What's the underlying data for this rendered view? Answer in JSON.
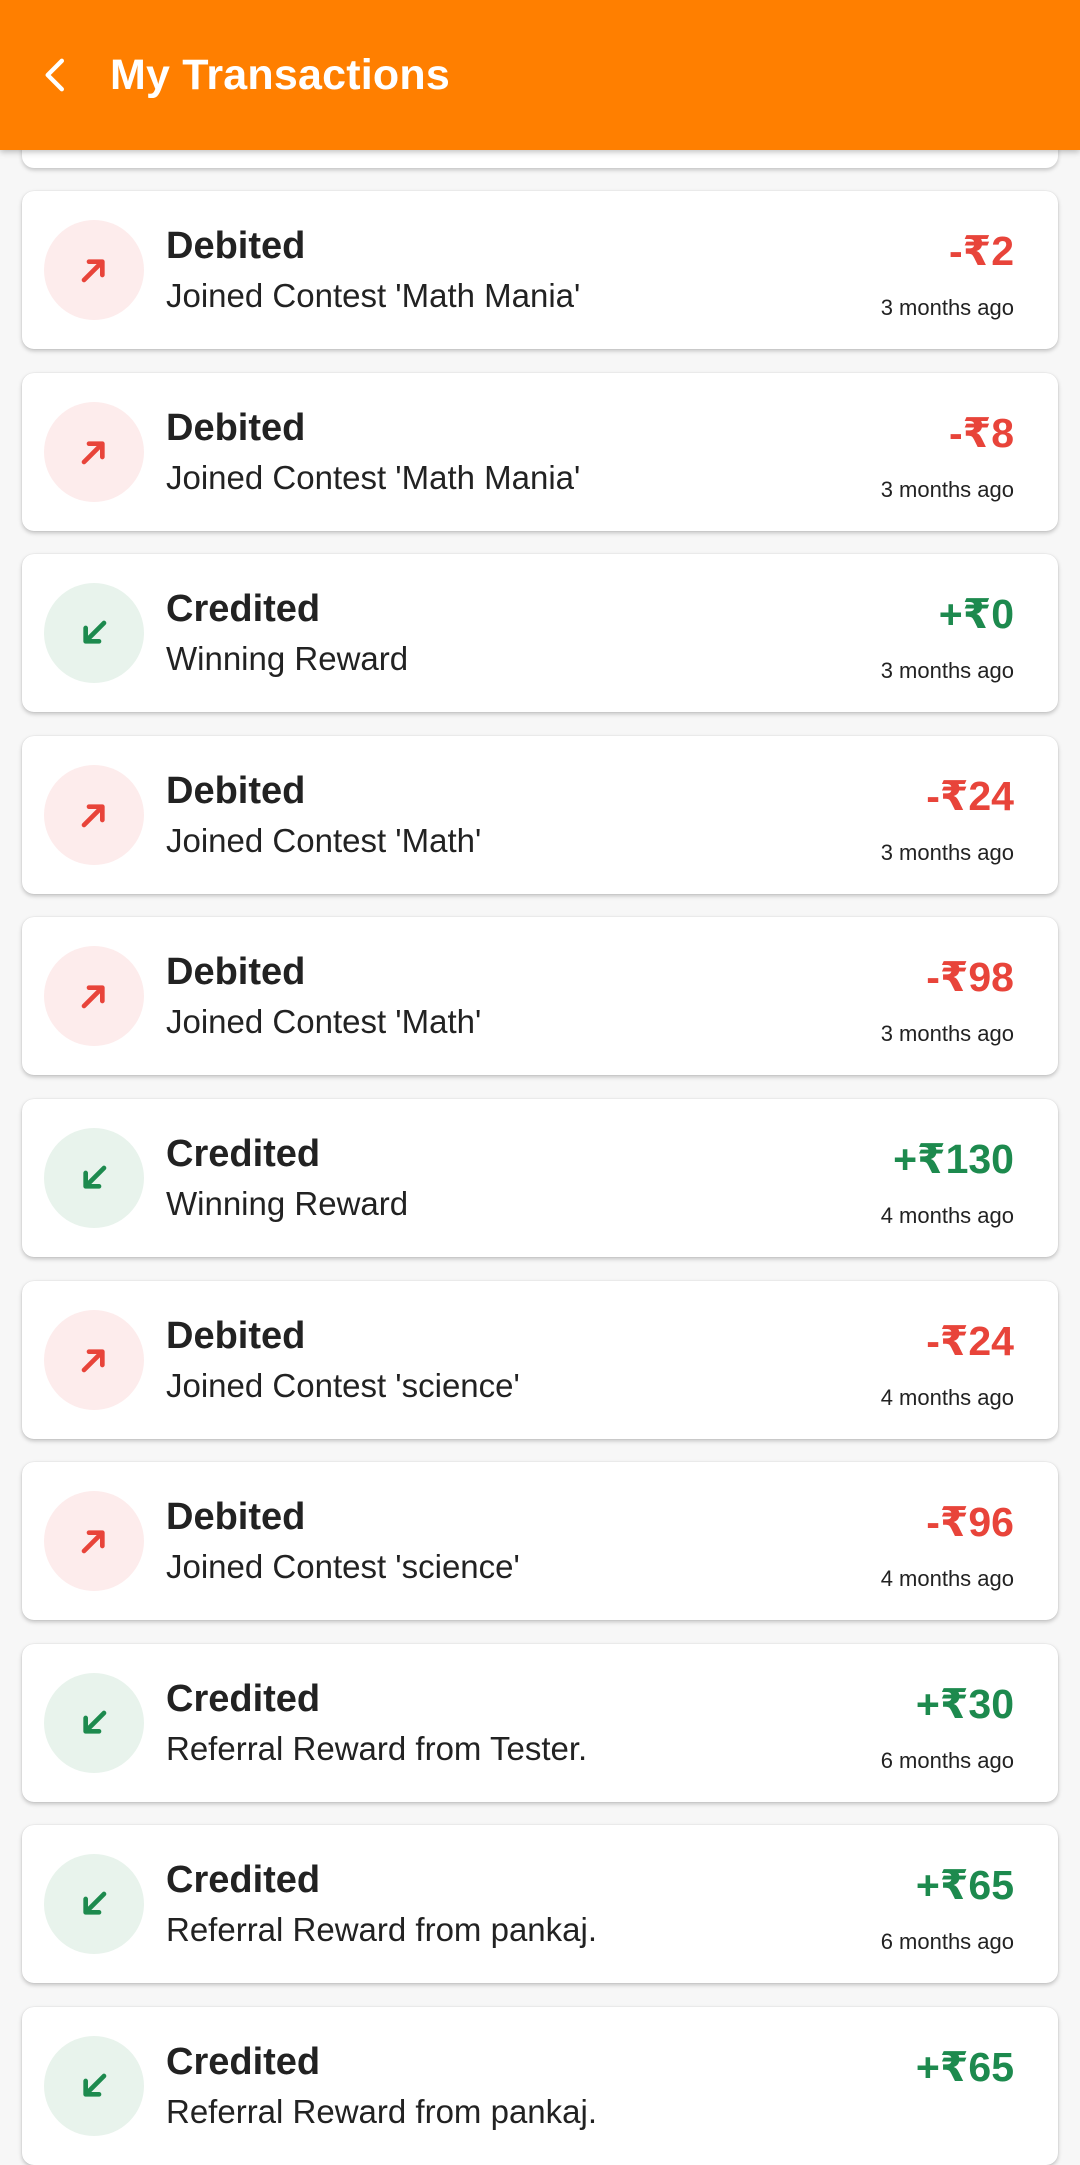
{
  "header": {
    "title": "My Transactions",
    "back_icon": "arrow-back-icon"
  },
  "colors": {
    "header_bg": "#ff7f00",
    "debit": "#e8443a",
    "debit_bg": "#fdecec",
    "credit": "#1d8a4e",
    "credit_bg": "#e8f3ec"
  },
  "transactions": [
    {
      "type": "Debited",
      "description": "Joined Contest 'Math Mania'",
      "amount": "-₹2",
      "time": "3 months ago",
      "kind": "debit"
    },
    {
      "type": "Debited",
      "description": "Joined Contest 'Math Mania'",
      "amount": "-₹8",
      "time": "3 months ago",
      "kind": "debit"
    },
    {
      "type": "Credited",
      "description": "Winning Reward",
      "amount": "+₹0",
      "time": "3 months ago",
      "kind": "credit"
    },
    {
      "type": "Debited",
      "description": "Joined Contest 'Math'",
      "amount": "-₹24",
      "time": "3 months ago",
      "kind": "debit"
    },
    {
      "type": "Debited",
      "description": "Joined Contest 'Math'",
      "amount": "-₹98",
      "time": "3 months ago",
      "kind": "debit"
    },
    {
      "type": "Credited",
      "description": "Winning Reward",
      "amount": "+₹130",
      "time": "4 months ago",
      "kind": "credit"
    },
    {
      "type": "Debited",
      "description": "Joined Contest 'science'",
      "amount": "-₹24",
      "time": "4 months ago",
      "kind": "debit"
    },
    {
      "type": "Debited",
      "description": "Joined Contest 'science'",
      "amount": "-₹96",
      "time": "4 months ago",
      "kind": "debit"
    },
    {
      "type": "Credited",
      "description": "Referral Reward from Tester.",
      "amount": "+₹30",
      "time": "6 months ago",
      "kind": "credit"
    },
    {
      "type": "Credited",
      "description": "Referral Reward from pankaj.",
      "amount": "+₹65",
      "time": "6 months ago",
      "kind": "credit"
    },
    {
      "type": "Credited",
      "description": "Referral Reward from pankaj.",
      "amount": "+₹65",
      "time": "",
      "kind": "credit"
    }
  ]
}
